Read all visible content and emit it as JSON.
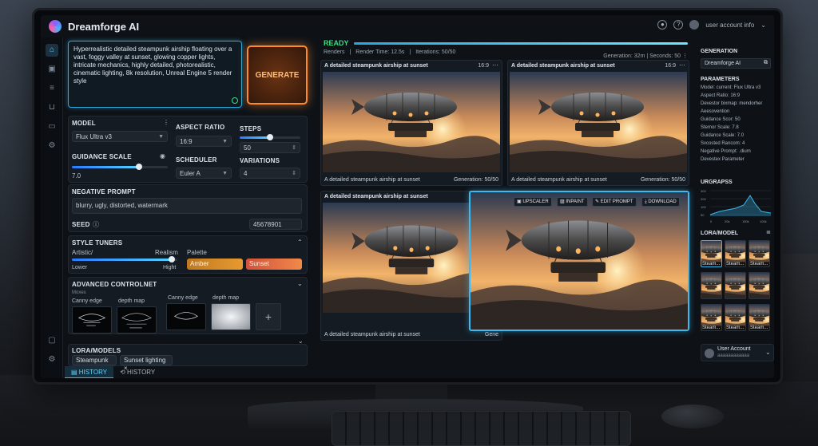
{
  "app": {
    "title": "Dreamforge AI",
    "account": "user account info"
  },
  "prompt": {
    "text": "Hyperrealistic detailed steampunk airship floating over a vast, foggy valley at sunset, glowing copper lights, intricate mechanics, highly detailed, photorealistic, cinematic lighting, 8k resolution, Unreal Engine 5 render style"
  },
  "generate_label": "GENERATE",
  "model": {
    "label": "MODEL",
    "value": "Flux Ultra v3"
  },
  "aspect_ratio": {
    "label": "ASPECT RATIO",
    "value": "16:9"
  },
  "steps": {
    "label": "STEPS",
    "value": "50",
    "fraction": 0.5
  },
  "guidance": {
    "label": "GUIDANCE SCALE",
    "value": "7.0",
    "fraction": 0.7
  },
  "scheduler": {
    "label": "SCHEDULER",
    "value": "Euler A"
  },
  "variations": {
    "label": "VARIATIONS",
    "value": "4"
  },
  "negative_prompt": {
    "label": "NEGATIVE PROMPT",
    "value": "blurry, ugly, distorted, watermark"
  },
  "seed": {
    "label": "SEED",
    "value": "45678901"
  },
  "style_tuners": {
    "label": "STYLE TUNERS",
    "left_label": "Artistic/",
    "right_label": "Realism",
    "low": "Lower",
    "high": "Hight",
    "fraction": 0.95,
    "palette_label": "Palette",
    "palette": [
      "Amber",
      "Sunset"
    ]
  },
  "controlnet": {
    "label": "ADVANCED CONTROLNET",
    "sub": "Moxes",
    "items": [
      "Canny edge",
      "depth map",
      "Canny edge",
      "depth map"
    ]
  },
  "loras": {
    "label": "LORA/MODELS",
    "chips": [
      "Steampunk",
      "Sunset lighting"
    ]
  },
  "tabs": [
    "HISTORY",
    "HISTORY"
  ],
  "status": {
    "label": "READY",
    "progress": 1.0,
    "renders": "Renders",
    "render_time": "Render Time: 12.5s",
    "iterations": "Iterations: 50/50",
    "right": "Generation: 32m | Seconds: 50"
  },
  "images": [
    {
      "title": "A detailed steampunk airship at sunset",
      "ar": "16:9",
      "caption": "A detailed steampunk airship at sunset",
      "gen": "Generation: 50/50"
    },
    {
      "title": "A detailed steampunk airship at sunset",
      "ar": "16:9",
      "caption": "A detailed steampunk airship at sunset",
      "gen": "Generation: 50/50"
    },
    {
      "title": "A detailed steampunk airship at sunset",
      "ar": "",
      "caption": "A detailed steampunk airship at sunset",
      "gen": "Gene"
    },
    {
      "title": "",
      "ar": "",
      "caption": "",
      "gen": ""
    }
  ],
  "actions": [
    "UPSCALER",
    "INPAINT",
    "EDIT PROMPT",
    "DOWNLOAD"
  ],
  "sidebar": {
    "generation_label": "GENERATION",
    "generation_value": "Dreamforge AI",
    "parameters_label": "PARAMETERS",
    "params": [
      "Model: current: Flux Ultra v3",
      "Aspect Ratio: 16:9",
      "Devestor bixmap: mendorher",
      "Aeesovention",
      "Guidance Scor: 50",
      "Stemor Scale: 7.8",
      "Guidance Scale: 7.0",
      "Svcosted Rancom: 4",
      "Negative Prompt: .dium",
      "Devestex Parameter"
    ],
    "graph_label": "URGRAPSS",
    "graph_y": [
      "300",
      "200",
      "100",
      "50"
    ],
    "graph_x": [
      "0",
      "20k",
      "150k",
      "100k"
    ],
    "lora_label": "LORA/MODEL",
    "lora_items": [
      "Steam...",
      "Steam...",
      "Steam...",
      "",
      "",
      "",
      "Steam...",
      "Steam...",
      "Steam..."
    ],
    "account_name": "User Account",
    "account_sub": "aaaaaaaaaaaa"
  },
  "colors": {
    "accent": "#37b8ea",
    "generate": "#ff8a2b",
    "ready": "#3ddc84"
  }
}
